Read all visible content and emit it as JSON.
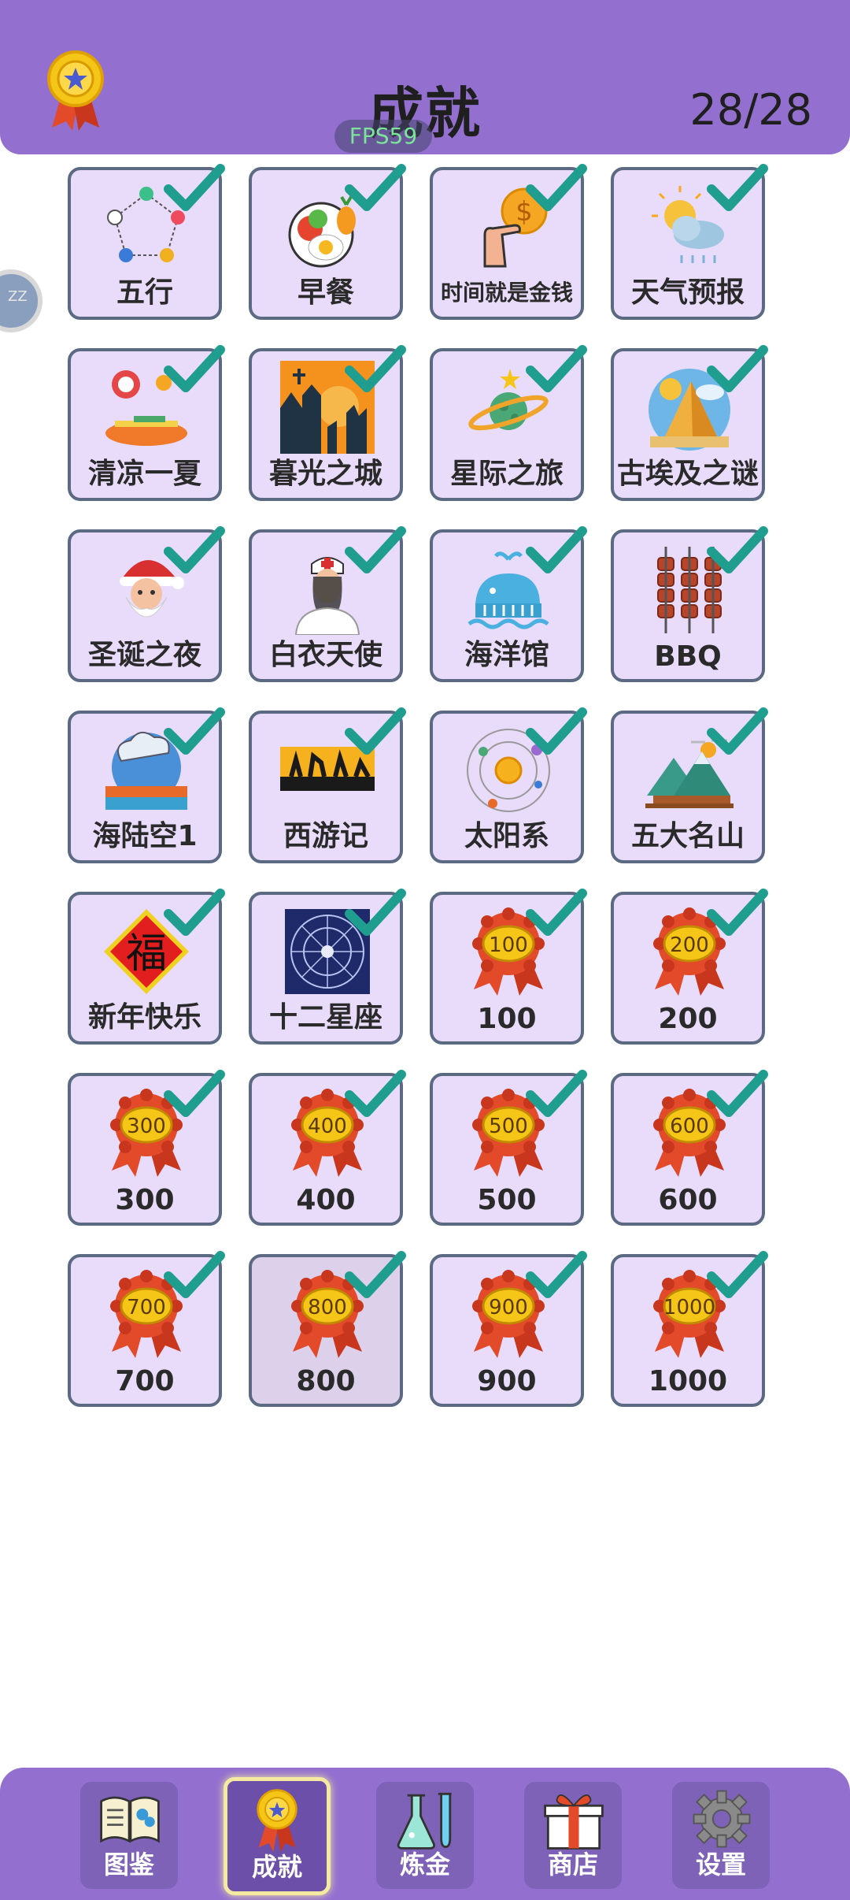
{
  "header": {
    "title": "成就",
    "count": "28/28",
    "fps": "FPS59"
  },
  "side_handle": "ZZ",
  "achievements": [
    {
      "label": "五行",
      "icon": "wuxing-icon"
    },
    {
      "label": "早餐",
      "icon": "breakfast-icon"
    },
    {
      "label": "时间就是金钱",
      "icon": "time-money-icon"
    },
    {
      "label": "天气预报",
      "icon": "weather-icon"
    },
    {
      "label": "清凉一夏",
      "icon": "summer-icon"
    },
    {
      "label": "暮光之城",
      "icon": "twilight-city-icon"
    },
    {
      "label": "星际之旅",
      "icon": "planet-icon"
    },
    {
      "label": "古埃及之谜",
      "icon": "pyramid-icon"
    },
    {
      "label": "圣诞之夜",
      "icon": "santa-icon"
    },
    {
      "label": "白衣天使",
      "icon": "nurse-icon"
    },
    {
      "label": "海洋馆",
      "icon": "whale-icon"
    },
    {
      "label": "BBQ",
      "icon": "bbq-icon"
    },
    {
      "label": "海陆空1",
      "icon": "sea-land-sky-icon"
    },
    {
      "label": "西游记",
      "icon": "journey-west-icon"
    },
    {
      "label": "太阳系",
      "icon": "solar-system-icon"
    },
    {
      "label": "五大名山",
      "icon": "mountains-icon"
    },
    {
      "label": "新年快乐",
      "icon": "fu-icon",
      "badge": "福"
    },
    {
      "label": "十二星座",
      "icon": "zodiac-icon"
    },
    {
      "label": "100",
      "icon": "ribbon-badge-icon",
      "badge": "100"
    },
    {
      "label": "200",
      "icon": "ribbon-badge-icon",
      "badge": "200"
    },
    {
      "label": "300",
      "icon": "ribbon-badge-icon",
      "badge": "300"
    },
    {
      "label": "400",
      "icon": "ribbon-badge-icon",
      "badge": "400"
    },
    {
      "label": "500",
      "icon": "ribbon-badge-icon",
      "badge": "500"
    },
    {
      "label": "600",
      "icon": "ribbon-badge-icon",
      "badge": "600"
    },
    {
      "label": "700",
      "icon": "ribbon-badge-icon",
      "badge": "700"
    },
    {
      "label": "800",
      "icon": "ribbon-badge-icon",
      "badge": "800",
      "selected": true
    },
    {
      "label": "900",
      "icon": "ribbon-badge-icon",
      "badge": "900"
    },
    {
      "label": "1000",
      "icon": "ribbon-badge-icon",
      "badge": "1000"
    }
  ],
  "nav": [
    {
      "label": "图鉴",
      "icon": "book-icon"
    },
    {
      "label": "成就",
      "icon": "medal-icon",
      "active": true
    },
    {
      "label": "炼金",
      "icon": "flask-icon"
    },
    {
      "label": "商店",
      "icon": "gift-icon"
    },
    {
      "label": "设置",
      "icon": "gear-icon"
    }
  ],
  "colors": {
    "accent": "#9370cf",
    "cell_bg": "#e8dcfa",
    "check": "#1f9e8f",
    "badge_gold": "#f5c518",
    "ribbon": "#e24a2a"
  }
}
